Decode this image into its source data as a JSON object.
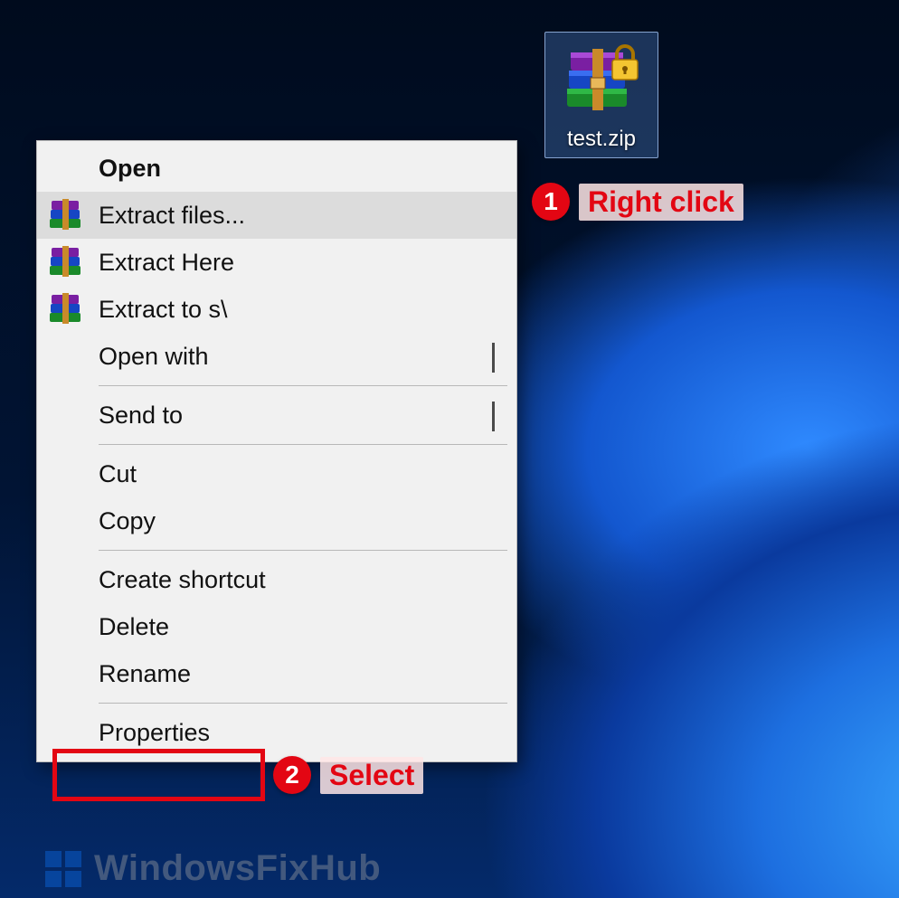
{
  "file": {
    "name": "test.zip"
  },
  "menu": {
    "open": "Open",
    "extract_files": "Extract files...",
    "extract_here": "Extract Here",
    "extract_to": "Extract to s\\",
    "open_with": "Open with",
    "send_to": "Send to",
    "cut": "Cut",
    "copy": "Copy",
    "create_shortcut": "Create shortcut",
    "delete": "Delete",
    "rename": "Rename",
    "properties": "Properties"
  },
  "annotations": {
    "step1_num": "1",
    "step1_label": "Right click",
    "step2_num": "2",
    "step2_label": "Select"
  },
  "watermark": "WindowsFixHub"
}
